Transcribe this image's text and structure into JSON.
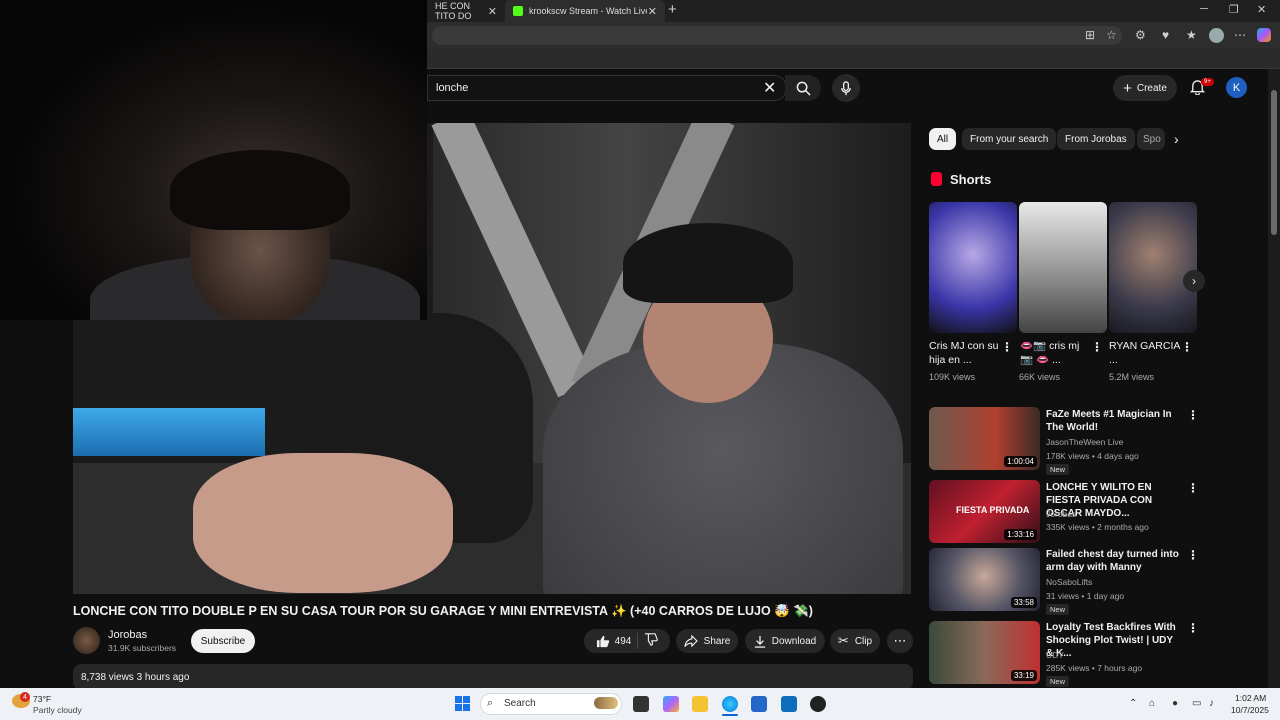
{
  "browser": {
    "tabs": [
      {
        "title": "HE CON TITO DO"
      },
      {
        "title": "krookscw Stream - Watch Live on"
      }
    ]
  },
  "youtube": {
    "search": {
      "value": "lonche"
    },
    "create_label": "Create",
    "notifications_badge": "9+",
    "account_initial": "K"
  },
  "video": {
    "title": "LONCHE CON TITO DOUBLE P EN SU CASA TOUR POR SU GARAGE Y MINI ENTREVISTA ✨ (+40 CARROS DE LUJO 🤯 💸)",
    "channel": "Jorobas",
    "subscribers": "31.9K subscribers",
    "subscribe_label": "Subscribe",
    "likes": "494",
    "share_label": "Share",
    "download_label": "Download",
    "clip_label": "Clip",
    "views_date": "8,738 views  3 hours ago"
  },
  "sidebar": {
    "chips": [
      "All",
      "From your search",
      "From Jorobas",
      "Spo"
    ],
    "shorts_heading": "Shorts",
    "shorts": [
      {
        "title": "Cris MJ con su hija en ...",
        "views": "109K views"
      },
      {
        "title": "👄📷 cris mj 📷 👄 ...",
        "views": "66K views"
      },
      {
        "title": "RYAN GARCIA ...",
        "views": "5.2M views"
      }
    ],
    "recommendations": [
      {
        "title": "FaZe Meets #1 Magician In The World!",
        "channel": "JasonTheWeen Live",
        "meta": "178K views • 4 days ago",
        "duration": "1:00:04",
        "badge": "New"
      },
      {
        "title": "LONCHE Y WILITO EN FIESTA PRIVADA CON OSCAR MAYDO...",
        "channel": "Jorobas",
        "meta": "335K views • 2 months ago",
        "duration": "1:33:16",
        "badge": ""
      },
      {
        "title": "Failed chest day turned into arm day with Manny",
        "channel": "NoSaboLifts",
        "meta": "31 views • 1 day ago",
        "duration": "33:58",
        "badge": "New"
      },
      {
        "title": "Loyalty Test Backfires With Shocking Plot Twist! | UDY & K...",
        "channel": "UDY",
        "meta": "285K views • 7 hours ago",
        "duration": "33:19",
        "badge": "New"
      }
    ],
    "thumb_overlay_text": "FIESTA PRIVADA"
  },
  "taskbar": {
    "weather_temp": "73°F",
    "weather_desc": "Partly cloudy",
    "weather_badge": "4",
    "search_label": "Search",
    "time": "1:02 AM",
    "date": "10/7/2025"
  }
}
